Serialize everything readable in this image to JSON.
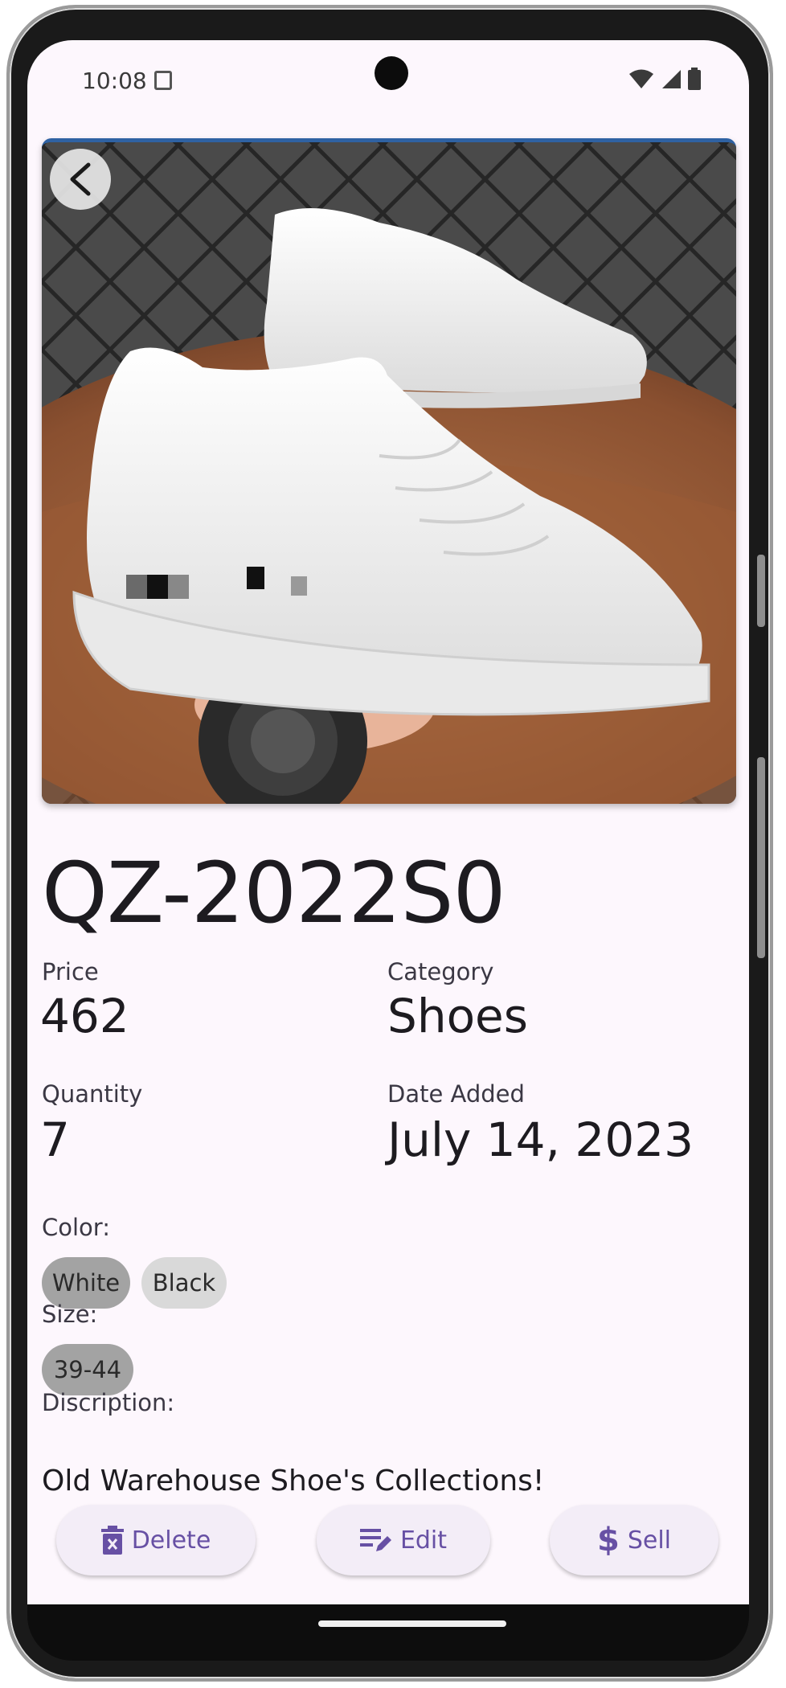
{
  "status_bar": {
    "time": "10:08"
  },
  "product": {
    "name": "QZ-2022S0",
    "image_alt": "White sneaker",
    "fields": {
      "price_label": "Price",
      "price_value": "462",
      "category_label": "Category",
      "category_value": "Shoes",
      "quantity_label": "Quantity",
      "quantity_value": "7",
      "date_label": "Date Added",
      "date_value": "July 14, 2023"
    },
    "color_label": "Color:",
    "colors": [
      {
        "label": "White",
        "selected": true
      },
      {
        "label": "Black",
        "selected": false
      }
    ],
    "size_label": "Size:",
    "sizes": [
      {
        "label": "39-44",
        "selected": true
      }
    ],
    "description_label": "Discription:",
    "description": "Old Warehouse Shoe's Collections!"
  },
  "actions": {
    "delete_label": "Delete",
    "edit_label": "Edit",
    "sell_label": "Sell"
  },
  "theme": {
    "accent": "#6750a4",
    "background": "#fdf7fd",
    "chip_selected": "#a3a3a3",
    "chip_unselected": "#d9d9d9"
  },
  "icons": {
    "back": "arrow-back-icon",
    "delete": "trash-icon",
    "edit": "edit-note-icon",
    "sell": "dollar-icon"
  }
}
